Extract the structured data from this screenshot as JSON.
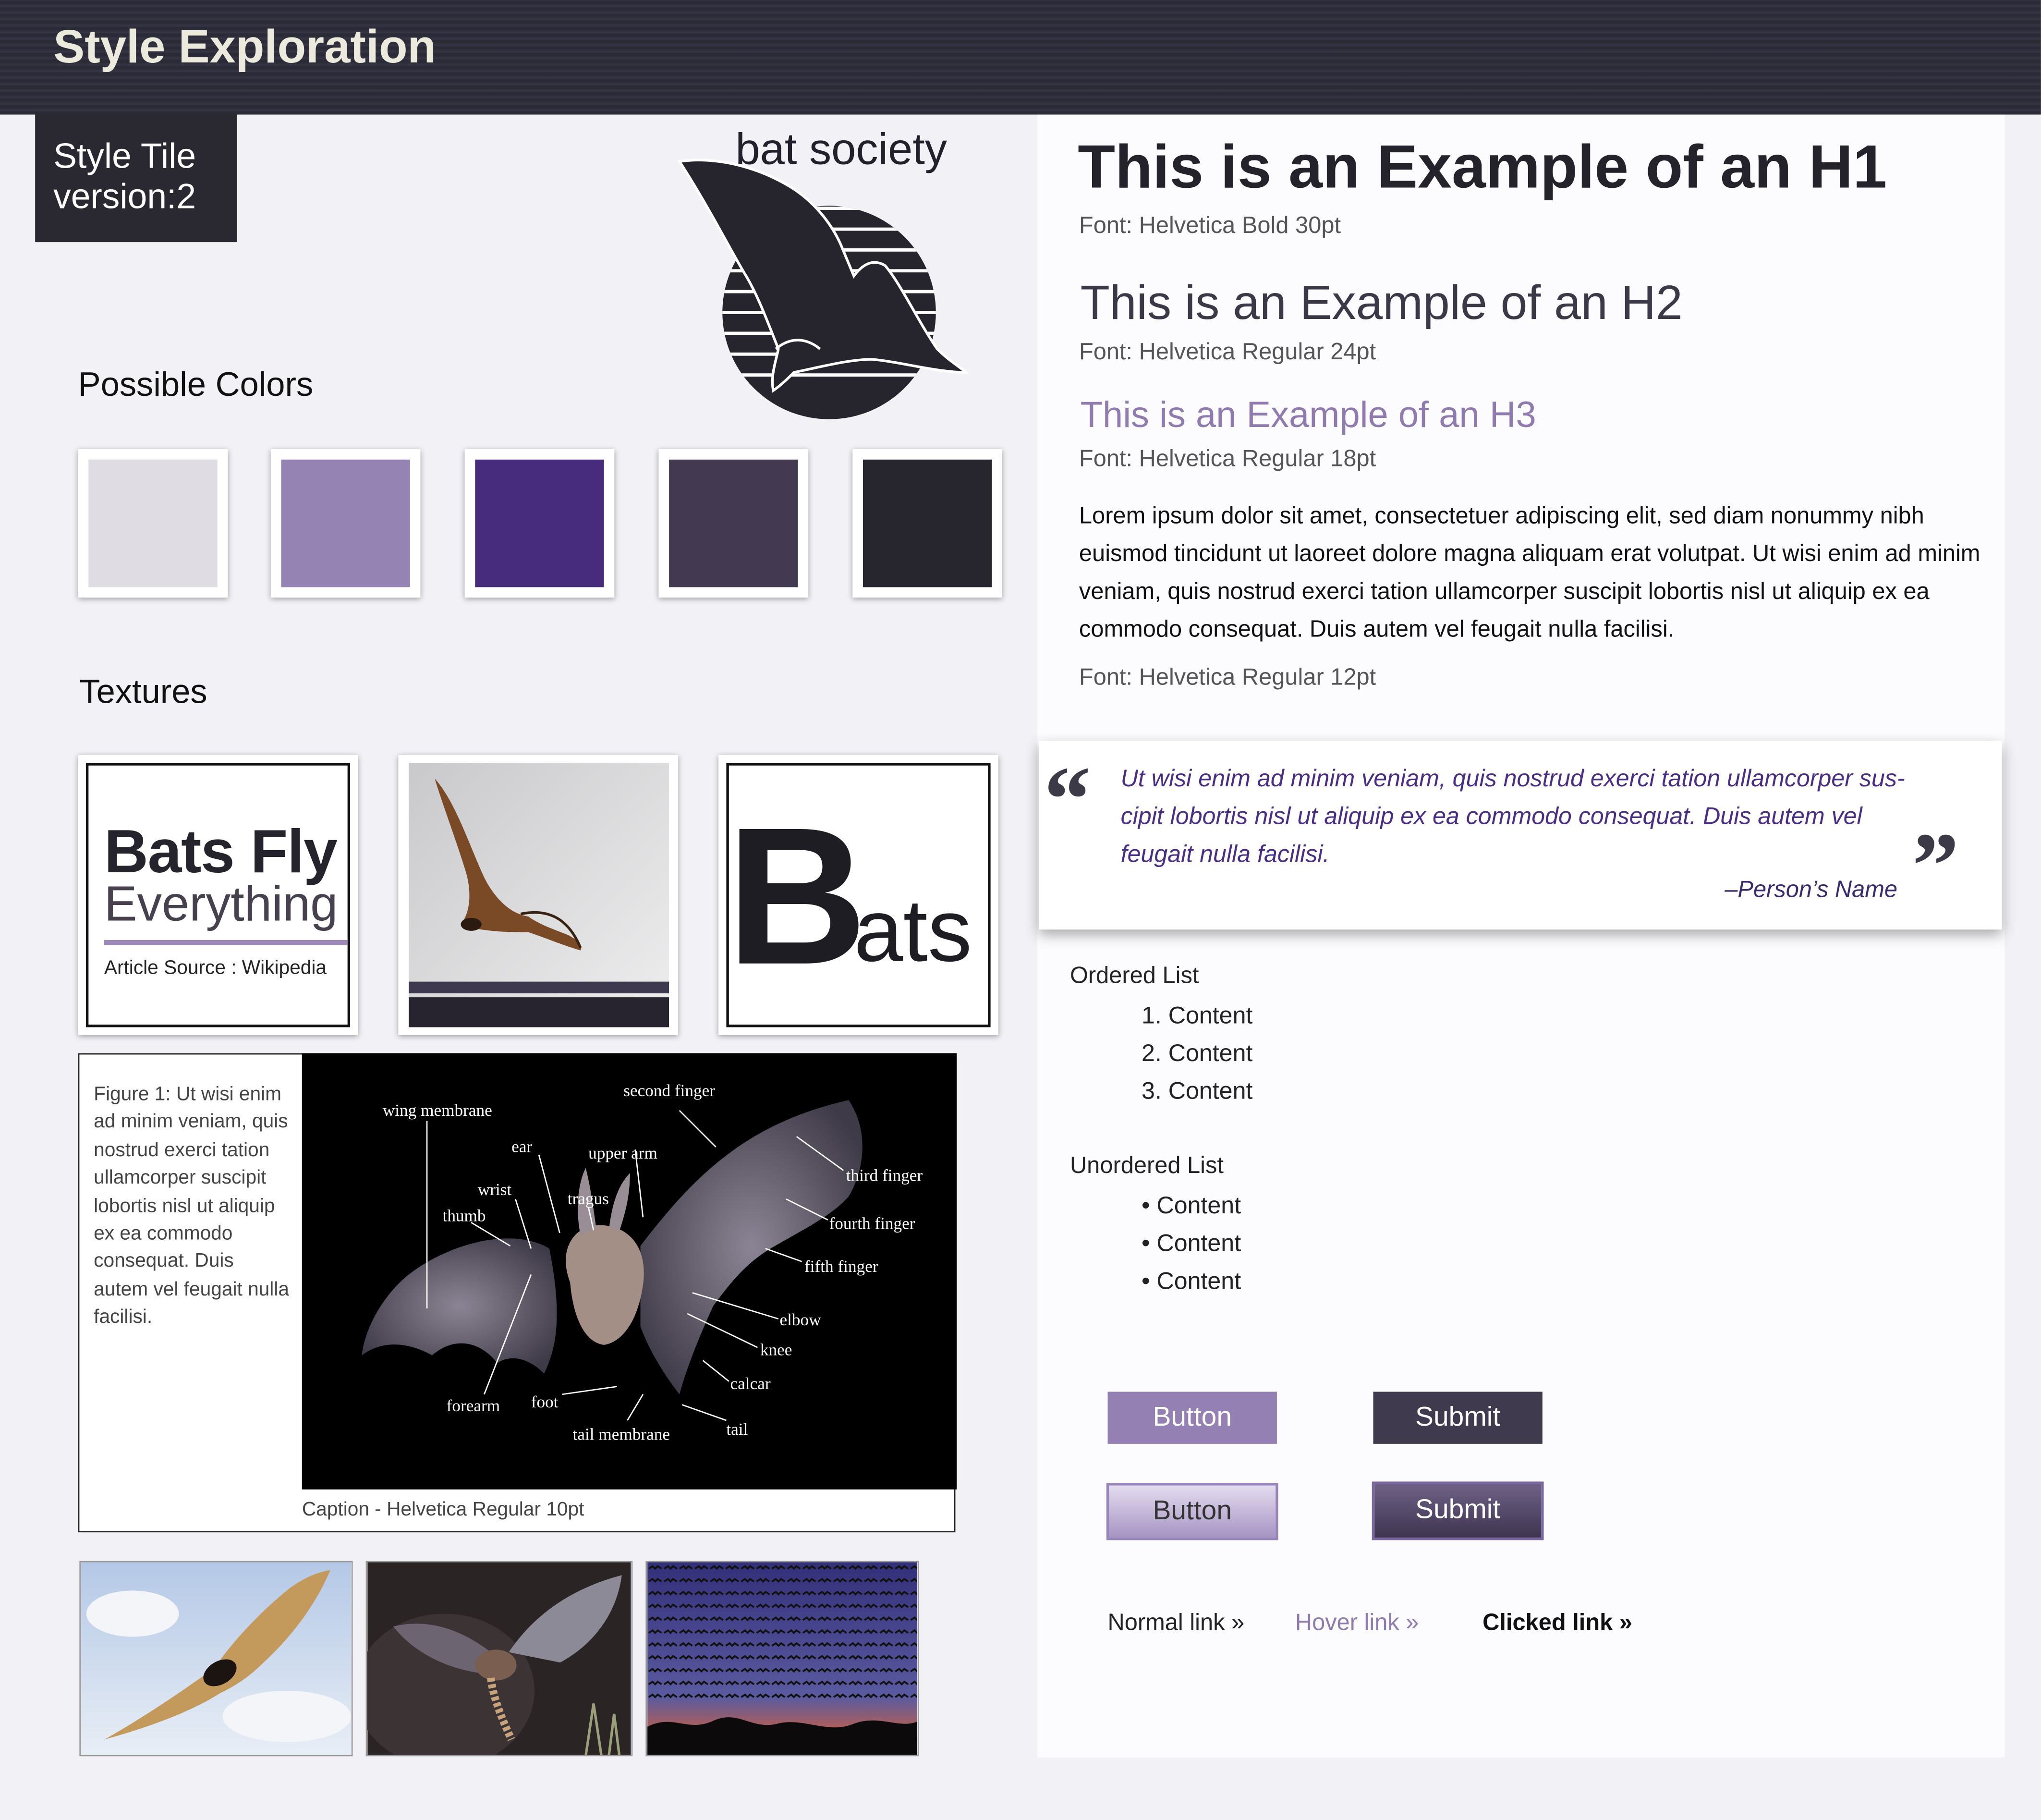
{
  "header": {
    "title": "Style Exploration"
  },
  "tile_label": {
    "line1": "Style Tile",
    "line2": "version:2"
  },
  "brand": {
    "name": "bat society"
  },
  "colors": {
    "heading": "Possible Colors",
    "swatches": [
      "#dfdce3",
      "#9583b3",
      "#472c7d",
      "#433a51",
      "#27252e"
    ]
  },
  "textures": {
    "heading": "Textures",
    "tile1": {
      "title": "Bats Fly",
      "subtitle": "Everything",
      "source": "Article Source : Wikipedia"
    },
    "tile3": {
      "big_letter": "B",
      "rest": "ats"
    }
  },
  "figure": {
    "text": "Figure 1: Ut wisi enim ad minim veniam, quis nostrud exerci tation ullamcorper suscipit lobortis nisl ut aliquip ex ea commodo consequat. Duis autem vel feugait nulla facilisi.",
    "caption": "Caption - Helvetica Regular 10pt",
    "labels": {
      "wing_membrane": "wing membrane",
      "second_finger": "second finger",
      "ear": "ear",
      "upper_arm": "upper arm",
      "wrist": "wrist",
      "tragus": "tragus",
      "thumb": "thumb",
      "third_finger": "third finger",
      "fourth_finger": "fourth finger",
      "fifth_finger": "fifth finger",
      "elbow": "elbow",
      "knee": "knee",
      "calcar": "calcar",
      "forearm": "forearm",
      "foot": "foot",
      "tail": "tail",
      "tail_membrane": "tail membrane"
    }
  },
  "typography": {
    "h1": "This is an Example of an H1",
    "h1_note": "Font: Helvetica Bold 30pt",
    "h2": "This is an Example of an H2",
    "h2_note": "Font: Helvetica Regular 24pt",
    "h3": "This is an Example of an H3",
    "h3_note": "Font: Helvetica Regular 18pt",
    "body": "Lorem ipsum dolor sit amet, consectetuer adipiscing elit, sed diam nonummy nibh euismod tincidunt ut laoreet dolore magna aliquam erat volutpat. Ut wisi enim ad minim veniam, quis nostrud exerci tation ullamcorper suscipit lobortis nisl ut aliquip ex ea commodo consequat. Duis autem vel feugait nulla facilisi.",
    "body_note": "Font: Helvetica Regular 12pt"
  },
  "quote": {
    "open_mark": "“",
    "close_mark": "”",
    "text": "Ut wisi enim ad minim veniam, quis nostrud exerci tation ullamcorper sus-cipit lobortis nisl ut aliquip ex ea commodo consequat. Duis autem vel feugait nulla facilisi.",
    "author": "–Person’s Name"
  },
  "lists": {
    "ordered_heading": "Ordered List",
    "ordered_items": [
      "1. Content",
      "2. Content",
      "3. Content"
    ],
    "unordered_heading": "Unordered List",
    "unordered_items": [
      "• Content",
      "• Content",
      "• Content"
    ]
  },
  "buttons": {
    "flat_button": "Button",
    "flat_submit": "Submit",
    "gradient_button": "Button",
    "gradient_submit": "Submit"
  },
  "links": {
    "normal": "Normal link »",
    "hover": "Hover link »",
    "clicked": "Clicked link »"
  }
}
